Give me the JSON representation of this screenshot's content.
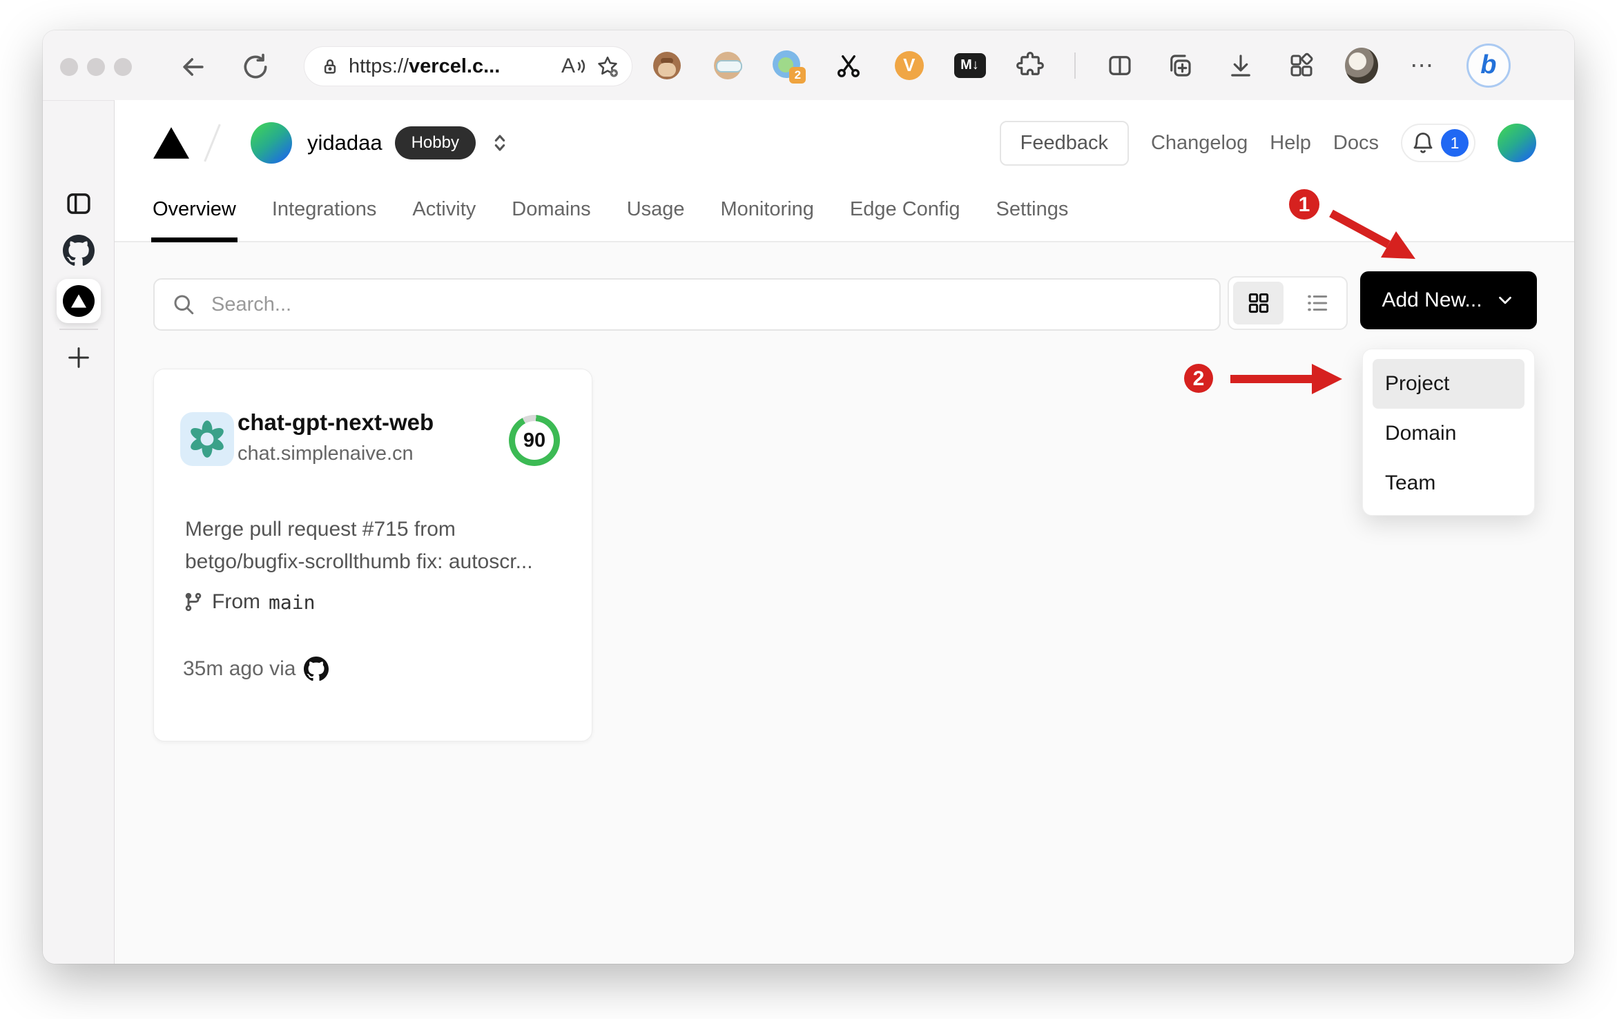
{
  "browser": {
    "address": {
      "scheme": "https://",
      "host": "vercel.c..."
    },
    "read_aloud_label": "A",
    "more_label": "⋯",
    "bing_label": "b"
  },
  "extensions": {
    "translate_badge": "2",
    "v_label": "V",
    "markdown_label": "M↓"
  },
  "team": {
    "name": "yidadaa",
    "plan": "Hobby"
  },
  "nav": {
    "feedback": "Feedback",
    "changelog": "Changelog",
    "help": "Help",
    "docs": "Docs",
    "notification_count": "1"
  },
  "tabs": [
    "Overview",
    "Integrations",
    "Activity",
    "Domains",
    "Usage",
    "Monitoring",
    "Edge Config",
    "Settings"
  ],
  "toolbar": {
    "search_placeholder": "Search...",
    "add_new": "Add New..."
  },
  "dropdown": {
    "items": [
      "Project",
      "Domain",
      "Team"
    ]
  },
  "project": {
    "name": "chat-gpt-next-web",
    "domain": "chat.simplenaive.cn",
    "score": "90",
    "commit_line1": "Merge pull request #715 from",
    "commit_line2": "betgo/bugfix-scrollthumb fix: autoscr...",
    "from_label": "From",
    "branch": "main",
    "deployed": "35m ago via"
  },
  "annotations": {
    "step1": "1",
    "step2": "2"
  },
  "colors": {
    "annotation_red": "#d6211f",
    "notification_blue": "#2068f3",
    "gauge_green": "#3cba54",
    "openai_teal": "#3aa189",
    "button_black": "#000000"
  }
}
